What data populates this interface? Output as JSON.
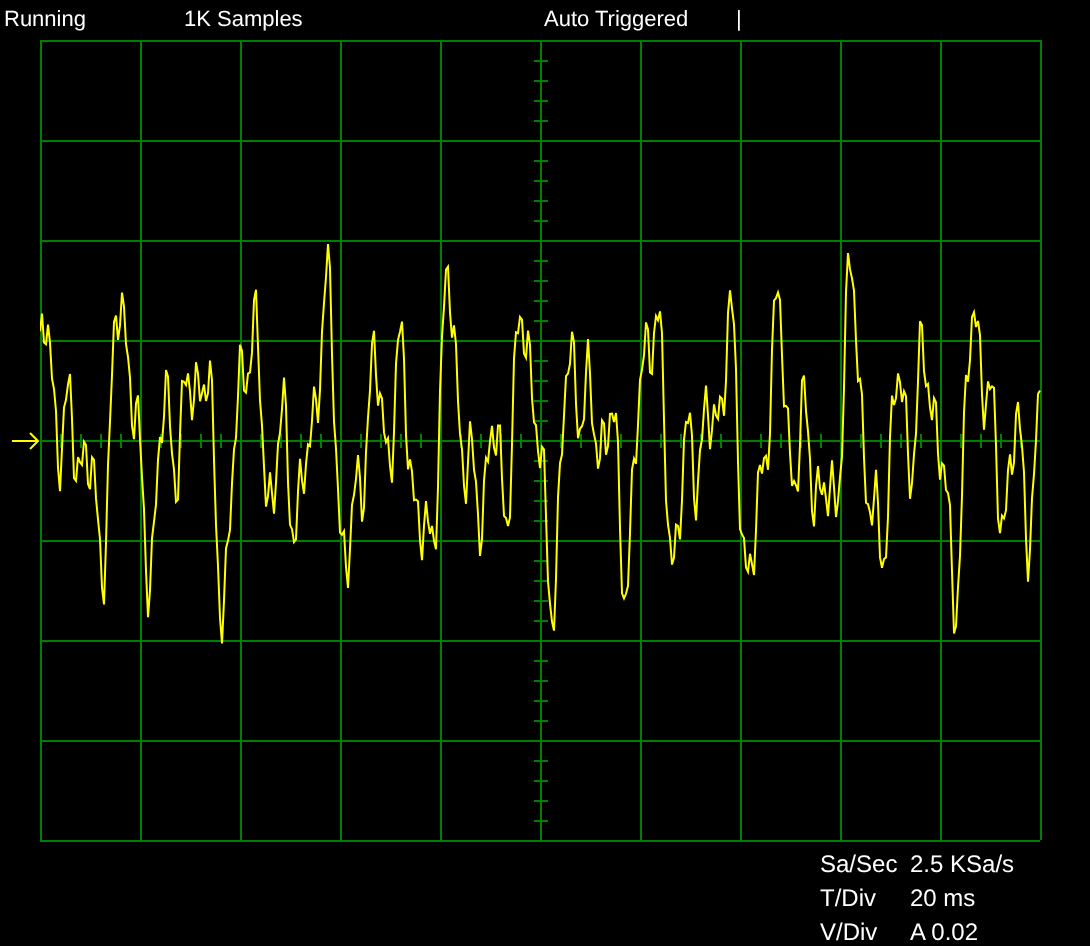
{
  "status": {
    "run_state": "Running",
    "samples": "1K Samples",
    "trigger": "Auto Triggered",
    "trigger_marker": "|"
  },
  "readouts": [
    {
      "label": "Sa/Sec",
      "value": "2.5 KSa/s"
    },
    {
      "label": "T/Div",
      "value": "20 ms"
    },
    {
      "label": "V/Div",
      "value": "A 0.02"
    }
  ]
}
